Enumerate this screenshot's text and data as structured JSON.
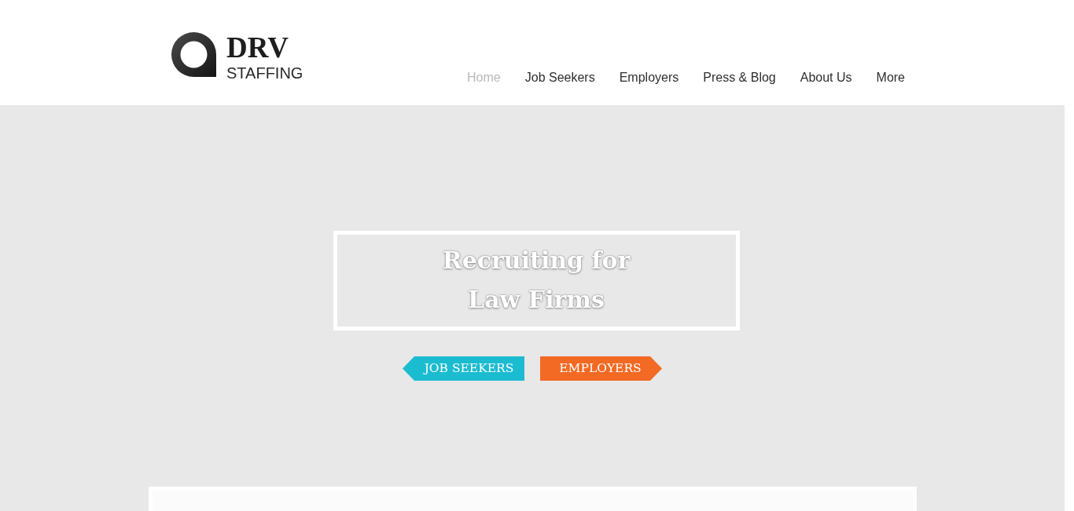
{
  "header": {
    "logo": {
      "name": "DRV",
      "tagline": "STAFFING"
    },
    "nav": [
      {
        "label": "Home",
        "selected": true
      },
      {
        "label": "Job Seekers",
        "selected": false
      },
      {
        "label": "Employers",
        "selected": false
      },
      {
        "label": "Press & Blog",
        "selected": false
      },
      {
        "label": "About Us",
        "selected": false
      },
      {
        "label": "More",
        "selected": false
      }
    ]
  },
  "hero": {
    "title": "Recruiting for Law Firms",
    "buttons": [
      {
        "label": "JOB SEEKERS",
        "kind": "arrow-left",
        "color": "#1bbcd0"
      },
      {
        "label": "EMPLOYERS",
        "kind": "arrow-right",
        "color": "#f26a24"
      }
    ]
  }
}
